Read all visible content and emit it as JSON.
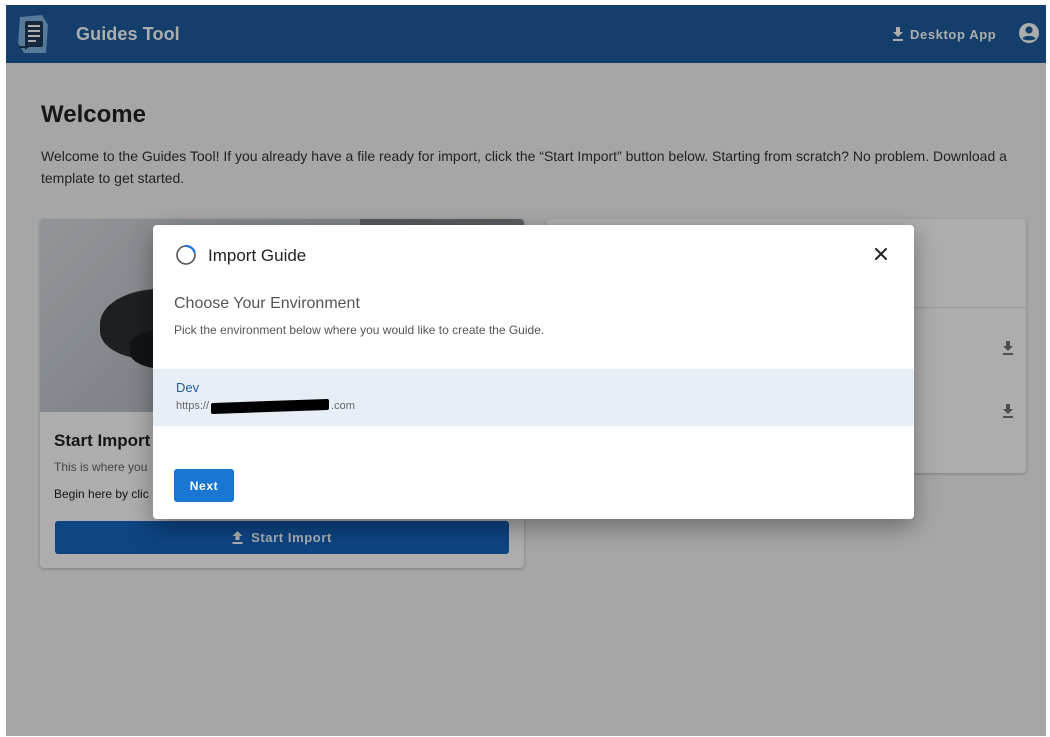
{
  "appbar": {
    "title": "Guides Tool",
    "desktop_app_label": "Desktop App",
    "color": "#1e5c9e"
  },
  "main": {
    "welcome_title": "Welcome",
    "welcome_text": "Welcome to the Guides Tool! If you already have a file ready for import, click the “Start Import” button below. Starting from scratch? No problem. Download a template to get started."
  },
  "start_card": {
    "title": "Start Import",
    "subtitle": "This is where you",
    "description": "Begin here by clic",
    "button_label": "Start Import"
  },
  "dialog": {
    "title": "Import Guide",
    "heading": "Choose Your Environment",
    "description": "Pick the environment below where you would like to create the Guide.",
    "environments": [
      {
        "name": "Dev",
        "url_prefix": "https://",
        "url_suffix": ".com"
      }
    ],
    "next_label": "Next"
  },
  "icons": {
    "logo": "guide-document-icon",
    "download": "download-icon",
    "account": "account-circle-icon",
    "close": "close-icon",
    "spinner": "loading-spinner-icon"
  },
  "colors": {
    "primary": "#1565c0",
    "selected_row": "#e8eef6"
  }
}
